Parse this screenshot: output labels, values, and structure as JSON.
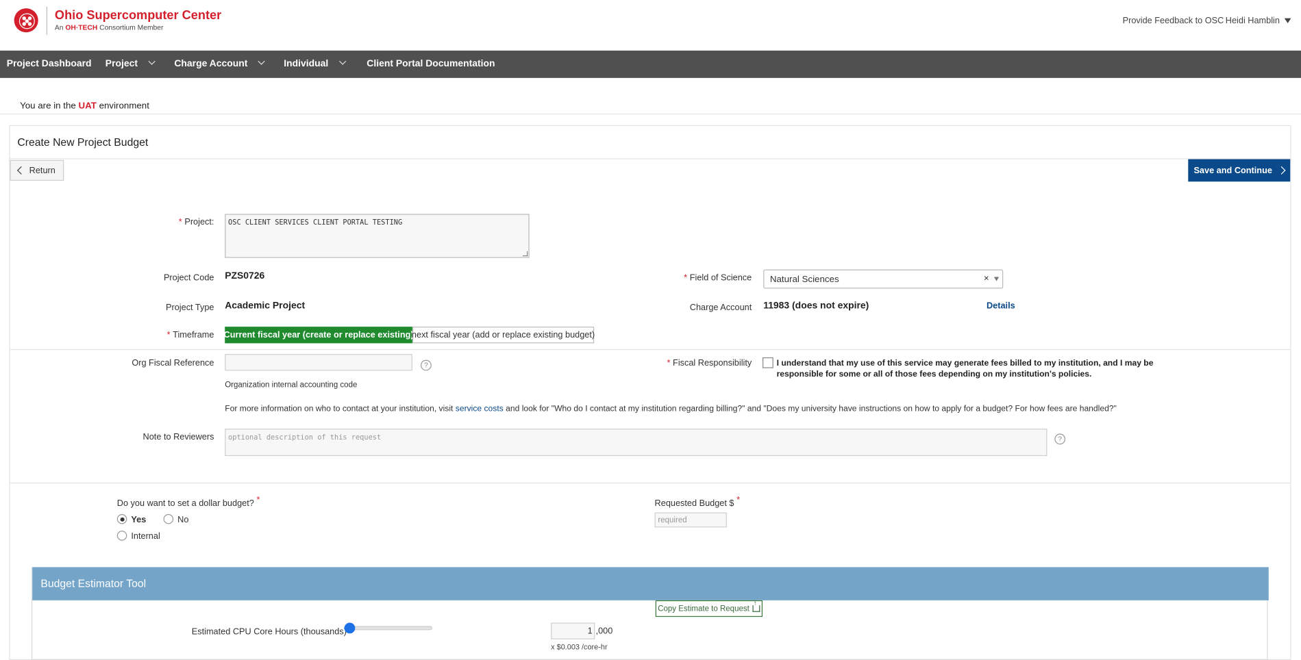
{
  "header": {
    "brand_name": "Ohio Supercomputer Center",
    "brand_sub_prefix": "An ",
    "brand_sub_oh": "OH·TECH",
    "brand_sub_suffix": " Consortium Member",
    "feedback_link": "Provide Feedback to OSC",
    "user_name": "Heidi Hamblin"
  },
  "nav": {
    "items": [
      {
        "label": "Project Dashboard"
      },
      {
        "label": "Project"
      },
      {
        "label": "Charge Account"
      },
      {
        "label": "Individual"
      },
      {
        "label": "Client Portal Documentation"
      }
    ]
  },
  "environment": {
    "prefix": "You are in the ",
    "name": "UAT",
    "suffix": " environment"
  },
  "page": {
    "title": "Create New Project Budget",
    "return_label": "Return",
    "save_label": "Save and Continue"
  },
  "form": {
    "project_label": "Project:",
    "project_value": "OSC CLIENT SERVICES CLIENT PORTAL TESTING",
    "project_code_label": "Project Code",
    "project_code_value": "PZS0726",
    "project_type_label": "Project Type",
    "project_type_value": "Academic Project",
    "timeframe_label": "Timeframe",
    "timeframe_options": [
      "Current fiscal year (create or replace existing)",
      "next fiscal year (add or replace existing budget)"
    ],
    "field_of_science_label": "Field of Science",
    "field_of_science_value": "Natural Sciences",
    "charge_account_label": "Charge Account",
    "charge_account_value": "11983 (does not expire)",
    "details_link": "Details",
    "org_ref_label": "Org Fiscal Reference",
    "org_ref_help": "Organization internal accounting code",
    "fiscal_resp_label": "Fiscal Responsibility",
    "fiscal_resp_text": "I understand that my use of this service may generate fees billed to my institution, and I may be responsible for some or all of those fees depending on my institution's policies.",
    "info_prefix": "For more information on who to contact at your institution, visit ",
    "info_link": "service costs",
    "info_suffix": " and look for \"Who do I contact at my institution regarding billing?\" and \"Does my university have instructions on how to apply for a budget? For how fees are handled?\"",
    "note_label": "Note to Reviewers",
    "note_placeholder": "optional description of this request",
    "help_glyph": "?",
    "required_mark": "*"
  },
  "budget": {
    "question": "Do you want to set a dollar budget?",
    "options": [
      "Yes",
      "No",
      "Internal"
    ],
    "selected": "Yes",
    "requested_label": "Requested Budget $",
    "requested_placeholder": "required"
  },
  "estimator": {
    "title": "Budget Estimator Tool",
    "copy_button": "Copy Estimate to Request",
    "cpu_label": "Estimated CPU Core Hours (thousands)",
    "cpu_value": "1",
    "cpu_suffix": ",000",
    "cpu_rate": "x $0.003 /core-hr",
    "slider_fraction": 0.0
  }
}
